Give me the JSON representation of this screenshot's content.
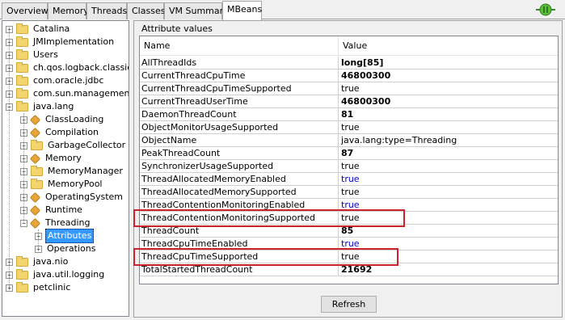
{
  "tabs": [
    "Overview",
    "Memory",
    "Threads",
    "Classes",
    "VM Summary",
    "MBeans"
  ],
  "active_tab": "MBeans",
  "tree": [
    {
      "label": "Catalina",
      "expander": "+",
      "icon": "folder-icon"
    },
    {
      "label": "JMImplementation",
      "expander": "+",
      "icon": "folder-icon"
    },
    {
      "label": "Users",
      "expander": "+",
      "icon": "folder-icon"
    },
    {
      "label": "ch.qos.logback.classic",
      "expander": "+",
      "icon": "folder-icon"
    },
    {
      "label": "com.oracle.jdbc",
      "expander": "+",
      "icon": "folder-icon"
    },
    {
      "label": "com.sun.management",
      "expander": "+",
      "icon": "folder-icon"
    },
    {
      "label": "java.lang",
      "expander": "−",
      "icon": "folder-icon"
    },
    {
      "label": "ClassLoading",
      "expander": "+",
      "icon": "bean-icon"
    },
    {
      "label": "Compilation",
      "expander": "+",
      "icon": "bean-icon"
    },
    {
      "label": "GarbageCollector",
      "expander": "+",
      "icon": "folder-icon"
    },
    {
      "label": "Memory",
      "expander": "+",
      "icon": "bean-icon"
    },
    {
      "label": "MemoryManager",
      "expander": "+",
      "icon": "folder-icon"
    },
    {
      "label": "MemoryPool",
      "expander": "+",
      "icon": "folder-icon"
    },
    {
      "label": "OperatingSystem",
      "expander": "+",
      "icon": "bean-icon"
    },
    {
      "label": "Runtime",
      "expander": "+",
      "icon": "bean-icon"
    },
    {
      "label": "Threading",
      "expander": "−",
      "icon": "bean-icon"
    },
    {
      "label": "Attributes",
      "expander": "+",
      "icon": "",
      "selected": true
    },
    {
      "label": "Operations",
      "expander": "+",
      "icon": ""
    },
    {
      "label": "java.nio",
      "expander": "+",
      "icon": "folder-icon"
    },
    {
      "label": "java.util.logging",
      "expander": "+",
      "icon": "folder-icon"
    },
    {
      "label": "petclinic",
      "expander": "+",
      "icon": "folder-icon"
    }
  ],
  "attributes_panel": {
    "title": "Attribute values",
    "col_name": "Name",
    "col_value": "Value",
    "rows": [
      {
        "name": "AllThreadIds",
        "value": "long[85]",
        "style": "bold"
      },
      {
        "name": "CurrentThreadCpuTime",
        "value": "46800300",
        "style": "bold"
      },
      {
        "name": "CurrentThreadCpuTimeSupported",
        "value": "true",
        "style": "plain"
      },
      {
        "name": "CurrentThreadUserTime",
        "value": "46800300",
        "style": "bold"
      },
      {
        "name": "DaemonThreadCount",
        "value": "81",
        "style": "bold"
      },
      {
        "name": "ObjectMonitorUsageSupported",
        "value": "true",
        "style": "plain"
      },
      {
        "name": "ObjectName",
        "value": "java.lang:type=Threading",
        "style": "plain"
      },
      {
        "name": "PeakThreadCount",
        "value": "87",
        "style": "bold"
      },
      {
        "name": "SynchronizerUsageSupported",
        "value": "true",
        "style": "plain"
      },
      {
        "name": "ThreadAllocatedMemoryEnabled",
        "value": "true",
        "style": "link"
      },
      {
        "name": "ThreadAllocatedMemorySupported",
        "value": "true",
        "style": "plain"
      },
      {
        "name": "ThreadContentionMonitoringEnabled",
        "value": "true",
        "style": "link"
      },
      {
        "name": "ThreadContentionMonitoringSupported",
        "value": "true",
        "style": "plain"
      },
      {
        "name": "ThreadCount",
        "value": "85",
        "style": "bold"
      },
      {
        "name": "ThreadCpuTimeEnabled",
        "value": "true",
        "style": "link"
      },
      {
        "name": "ThreadCpuTimeSupported",
        "value": "true",
        "style": "plain"
      },
      {
        "name": "TotalStartedThreadCount",
        "value": "21692",
        "style": "bold"
      }
    ],
    "highlighted_rows": [
      "ThreadContentionMonitoringSupported",
      "ThreadCpuTimeSupported"
    ],
    "highlight_color": "#cc2229"
  },
  "refresh_label": "Refresh",
  "colors": {
    "selection": "#3399ff",
    "link_value": "#0000cc",
    "folder": "#f3d36b",
    "bean": "#e7a53a"
  }
}
